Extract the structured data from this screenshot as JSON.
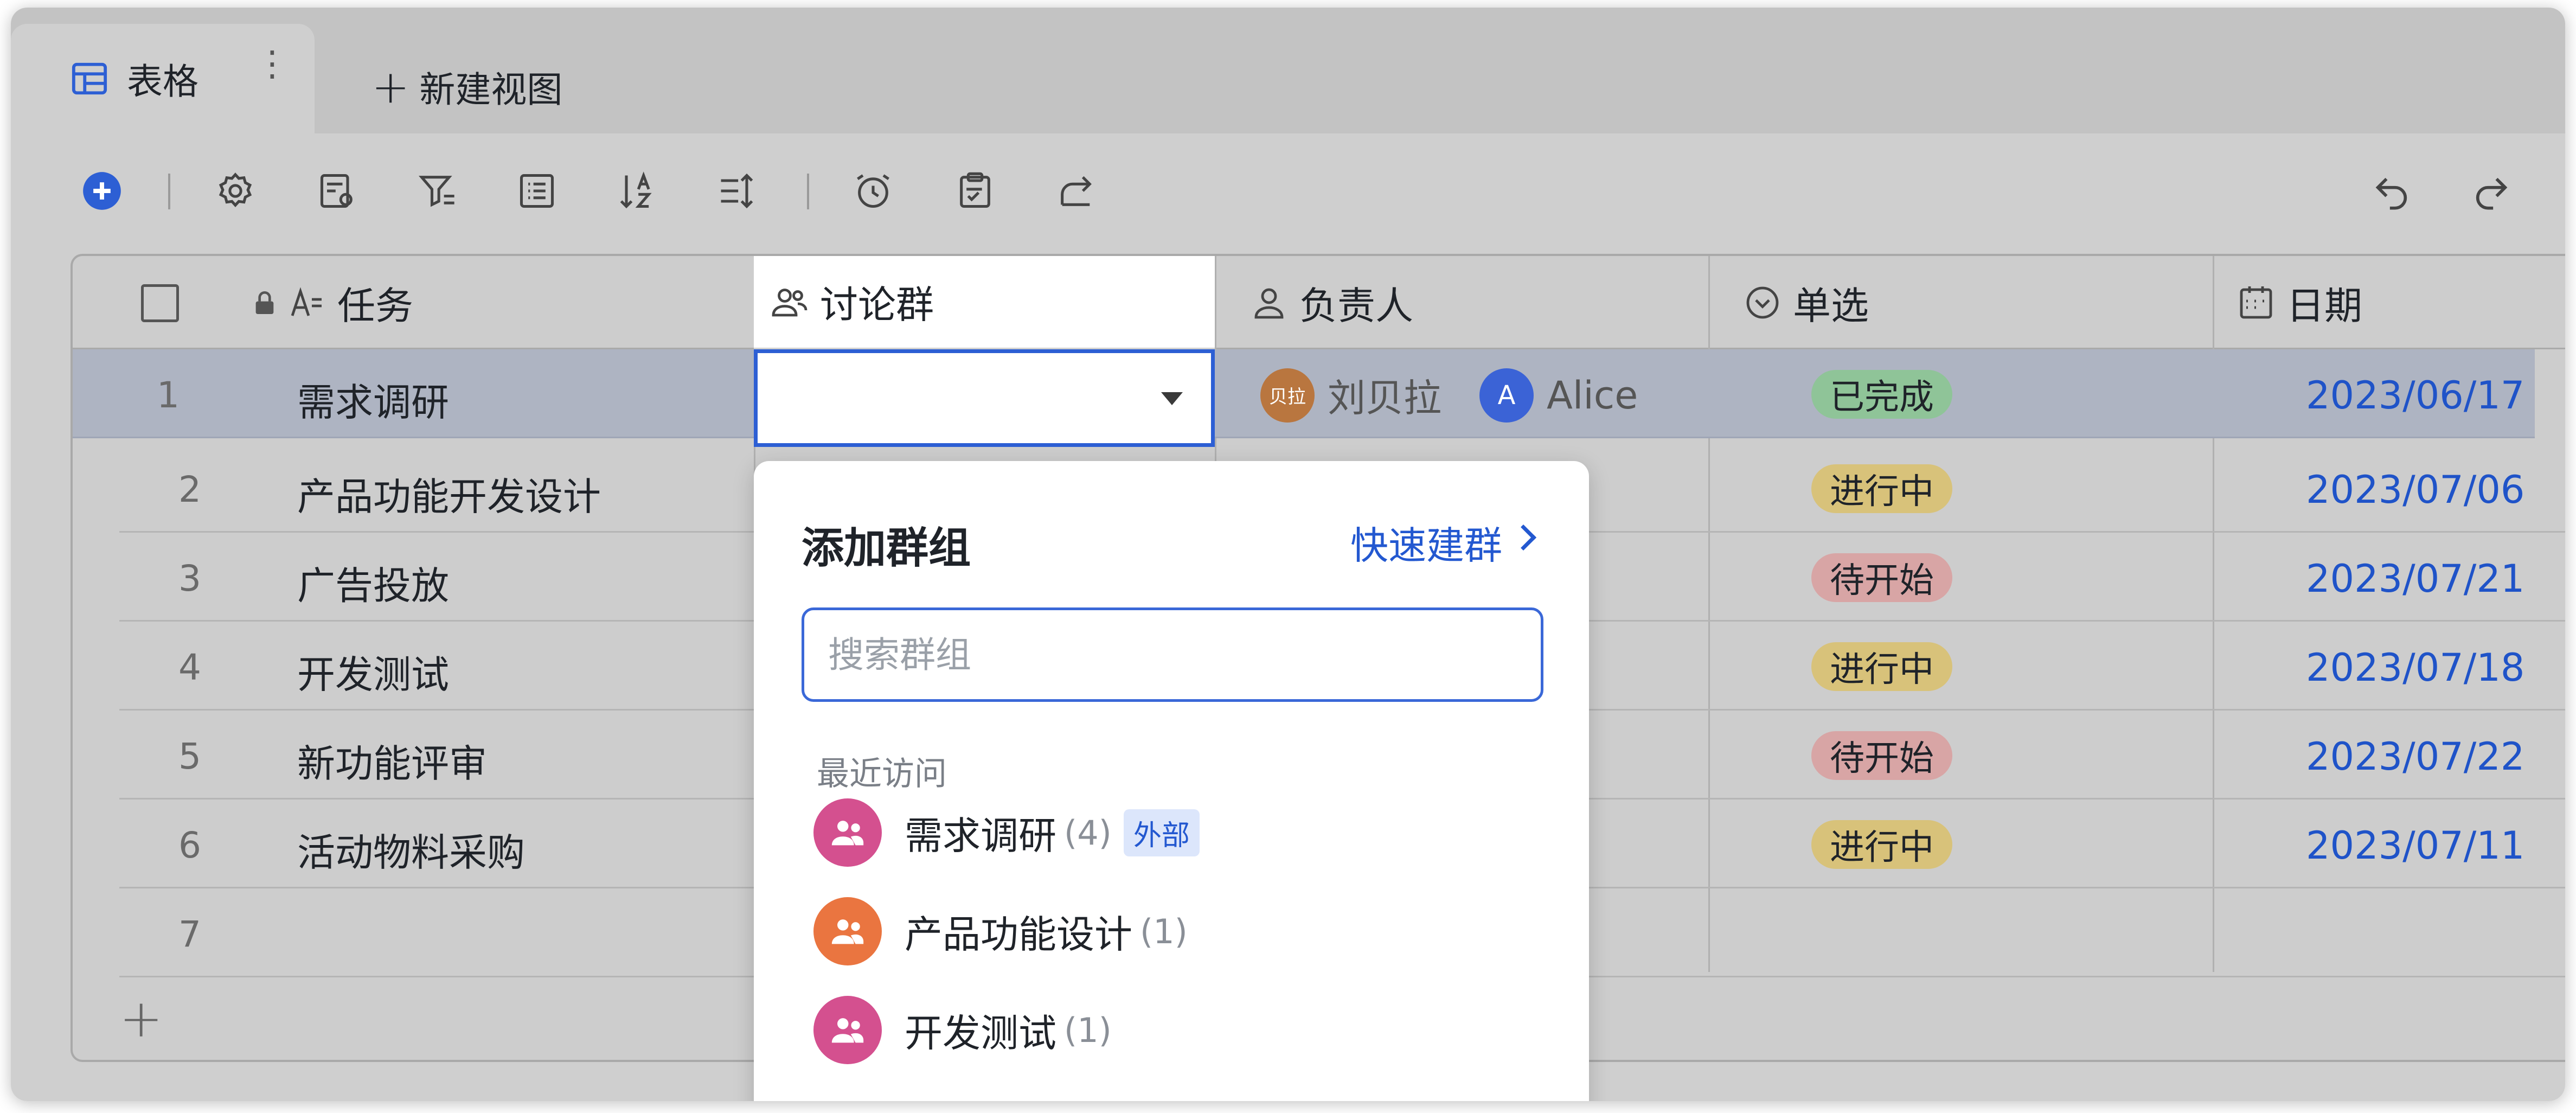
{
  "tabs": {
    "active_label": "表格",
    "more_label": "⋮",
    "new_view_label": "新建视图"
  },
  "toolbar": {
    "icons": [
      "add-record-icon",
      "settings-icon",
      "form-settings-icon",
      "filter-icon",
      "list-icon",
      "sort-icon",
      "row-height-icon",
      "alarm-icon",
      "clipboard-icon",
      "share-icon",
      "undo-icon",
      "redo-icon"
    ]
  },
  "table": {
    "columns": {
      "task": "任务",
      "group": "讨论群",
      "owner": "负责人",
      "select": "单选",
      "date": "日期"
    },
    "rows": [
      {
        "num": "1",
        "task": "需求调研",
        "status": "已完成",
        "status_color": "#8fc498",
        "date": "2023/06/17",
        "owners": [
          {
            "avatar_text": "贝拉",
            "name": "刘贝拉",
            "color": "#b9763f"
          },
          {
            "avatar_text": "A",
            "name": "Alice",
            "color": "#3b63d6"
          }
        ]
      },
      {
        "num": "2",
        "task": "产品功能开发设计",
        "status": "进行中",
        "status_color": "#d8c27a",
        "date": "2023/07/06"
      },
      {
        "num": "3",
        "task": "广告投放",
        "status": "待开始",
        "status_color": "#d8a5a5",
        "date": "2023/07/21"
      },
      {
        "num": "4",
        "task": "开发测试",
        "status": "进行中",
        "status_color": "#d8c27a",
        "date": "2023/07/18"
      },
      {
        "num": "5",
        "task": "新功能评审",
        "status": "待开始",
        "status_color": "#d8a5a5",
        "date": "2023/07/22"
      },
      {
        "num": "6",
        "task": "活动物料采购",
        "status": "进行中",
        "status_color": "#d8c27a",
        "date": "2023/07/11"
      },
      {
        "num": "7",
        "task": "",
        "status": "",
        "date": ""
      }
    ],
    "add_row_label": "+"
  },
  "dropdown": {
    "title": "添加群组",
    "quick_create": "快速建群",
    "search_placeholder": "搜索群组",
    "section_label": "最近访问",
    "groups": [
      {
        "name": "需求调研",
        "count": "(4)",
        "tag": "外部",
        "color": "#d4508f"
      },
      {
        "name": "产品功能设计",
        "count": "(1)",
        "tag": "",
        "color": "#ea7540"
      },
      {
        "name": "开发测试",
        "count": "(1)",
        "tag": "",
        "color": "#d4508f"
      }
    ]
  }
}
